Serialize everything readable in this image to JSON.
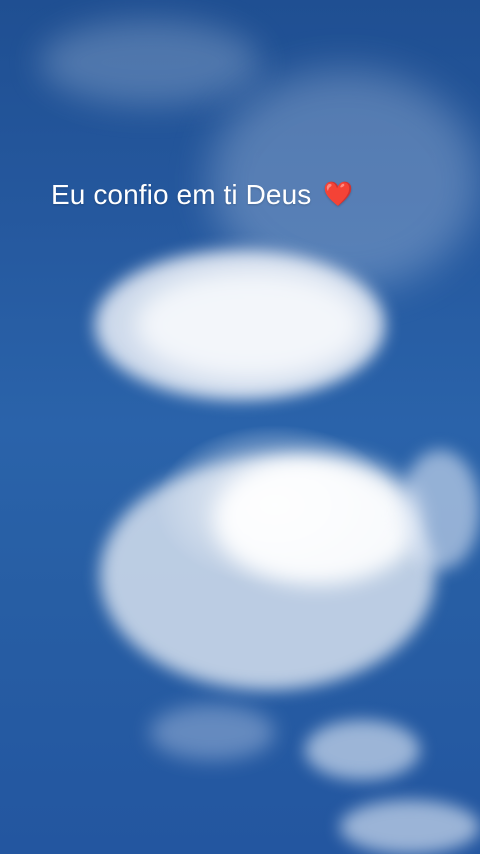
{
  "overlay": {
    "caption": "Eu confio em ti Deus",
    "emoji": "❤️"
  }
}
